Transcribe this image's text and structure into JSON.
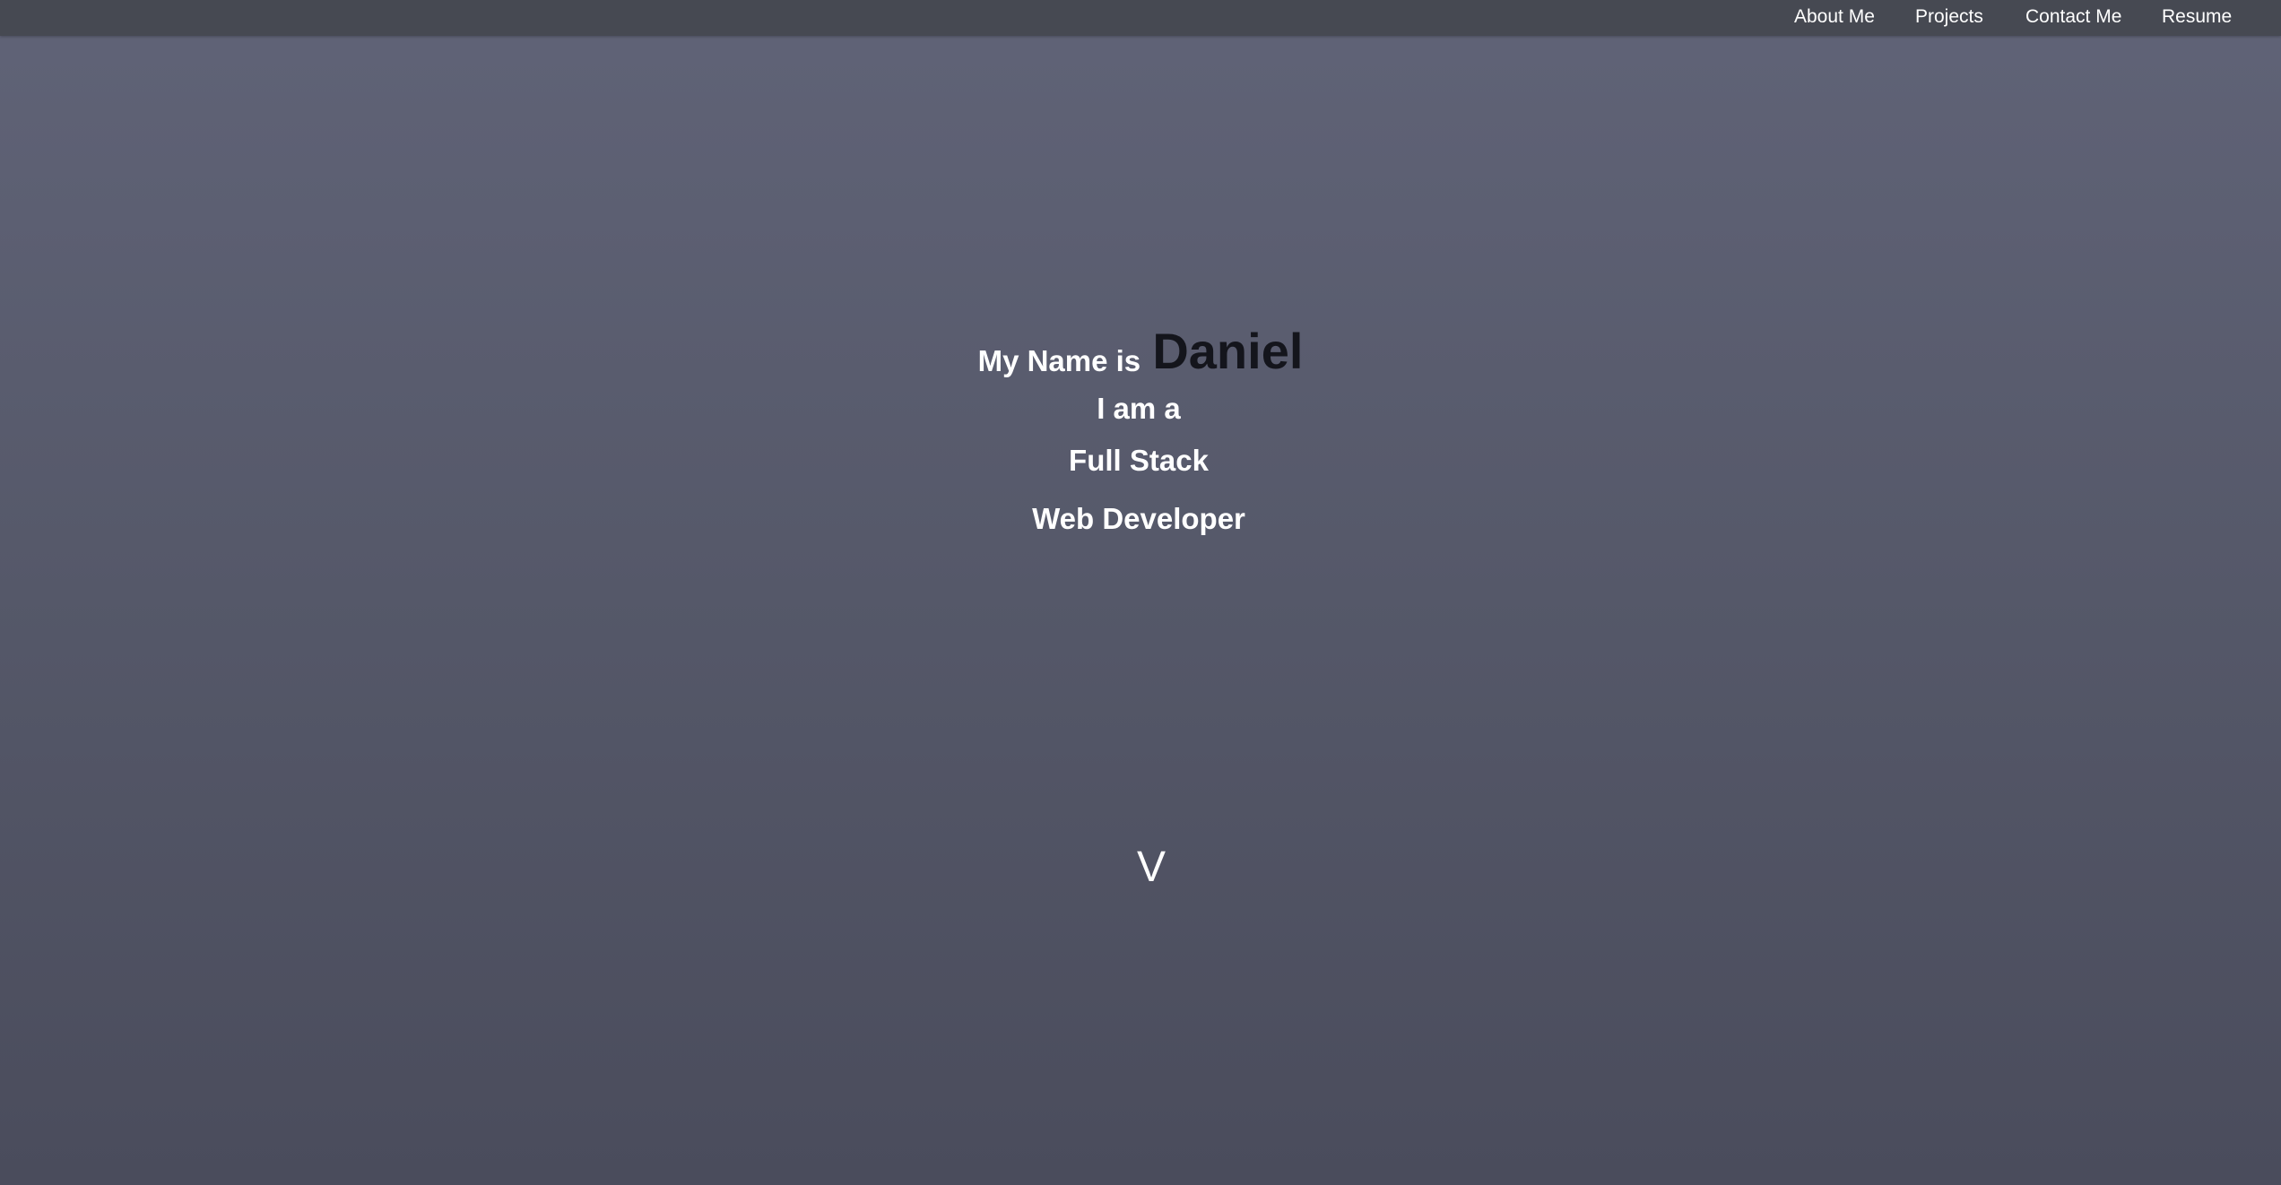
{
  "nav": {
    "items": [
      {
        "label": "About Me"
      },
      {
        "label": "Projects"
      },
      {
        "label": "Contact Me"
      },
      {
        "label": "Resume"
      }
    ]
  },
  "hero": {
    "intro": "My Name is",
    "name": "Daniel",
    "line1": "I am a",
    "line2": "Full Stack",
    "line3": "Web Developer"
  },
  "scroll": {
    "glyph": "V"
  },
  "colors": {
    "navbar_bg": "#464952",
    "page_bg_top": "#606377",
    "page_bg_bottom": "#4a4c5c",
    "name_text": "#14151c",
    "text": "#ffffff"
  }
}
